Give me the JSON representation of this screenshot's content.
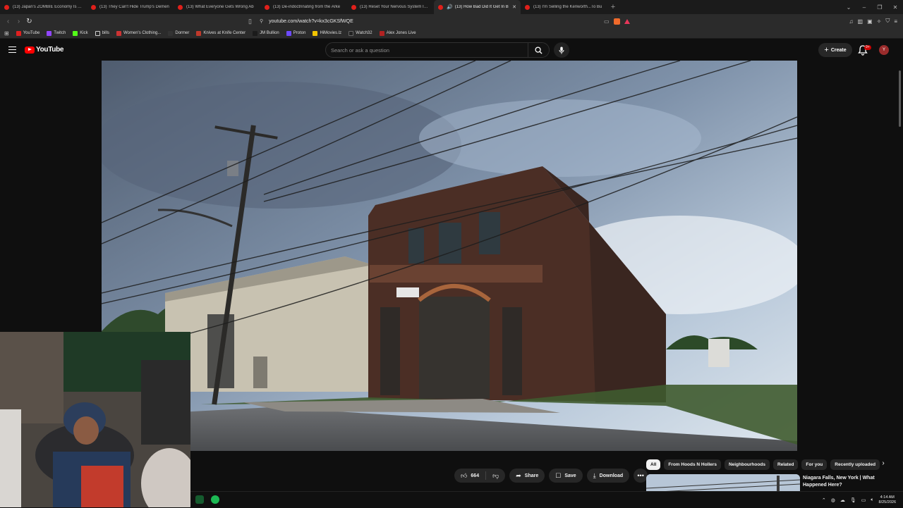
{
  "browser": {
    "tabs": [
      {
        "title": "(13) Japan's ZOMBIE Economy Is Abo",
        "active": false
      },
      {
        "title": "(13) They Can't Hide Trump's Demen",
        "active": false
      },
      {
        "title": "(13) What Everyone Gets Wrong Ab",
        "active": false
      },
      {
        "title": "(13) De-indoctrinating from the Arke",
        "active": false
      },
      {
        "title": "(13) Reset Your Nervous System In 8",
        "active": false
      },
      {
        "title": "(13) How Bad Did It Get In B",
        "active": true
      },
      {
        "title": "(13) I'm Selling the Kenworth...To Bu",
        "active": false
      }
    ],
    "url": "youtube.com/watch?v=kx3cGKSfWQE",
    "bookmarks": [
      {
        "label": "YouTube",
        "color": "#e02020"
      },
      {
        "label": "Twitch",
        "color": "#9146ff"
      },
      {
        "label": "Kick",
        "color": "#53fc18"
      },
      {
        "label": "bills",
        "color": "#cfcfcf"
      },
      {
        "label": "Women's Clothing...",
        "color": "#cc3333"
      },
      {
        "label": "Dormer",
        "color": "#333333"
      },
      {
        "label": "Knives at Knife Center",
        "color": "#c0392b"
      },
      {
        "label": "JM Bullion",
        "color": "#1b1b1b"
      },
      {
        "label": "Proton",
        "color": "#6d4aff"
      },
      {
        "label": "HiMovies.lz",
        "color": "#f2c400"
      },
      {
        "label": "Watch32",
        "color": "#222222"
      },
      {
        "label": "Alex Jones Live",
        "color": "#b22222"
      }
    ]
  },
  "youtube": {
    "logo_text": "YouTube",
    "search_placeholder": "Search or ask a question",
    "create_label": "Create",
    "notif_count": "9+",
    "avatar_letter": "Y"
  },
  "video_actions": {
    "like_count": "664",
    "share_label": "Share",
    "save_label": "Save",
    "download_label": "Download"
  },
  "chips": [
    "All",
    "From Hoods N Hollers",
    "Neighbourhoods",
    "Related",
    "For you",
    "Recently uploaded"
  ],
  "recommendation": {
    "title": "Niagara Falls, New York | What Happened Here?"
  },
  "taskbar": {
    "time": "4:14 AM",
    "date": "8/25/2026"
  },
  "colors": {
    "yt_red": "#ff0000",
    "bg": "#0f0f0f",
    "pill": "#272727"
  }
}
